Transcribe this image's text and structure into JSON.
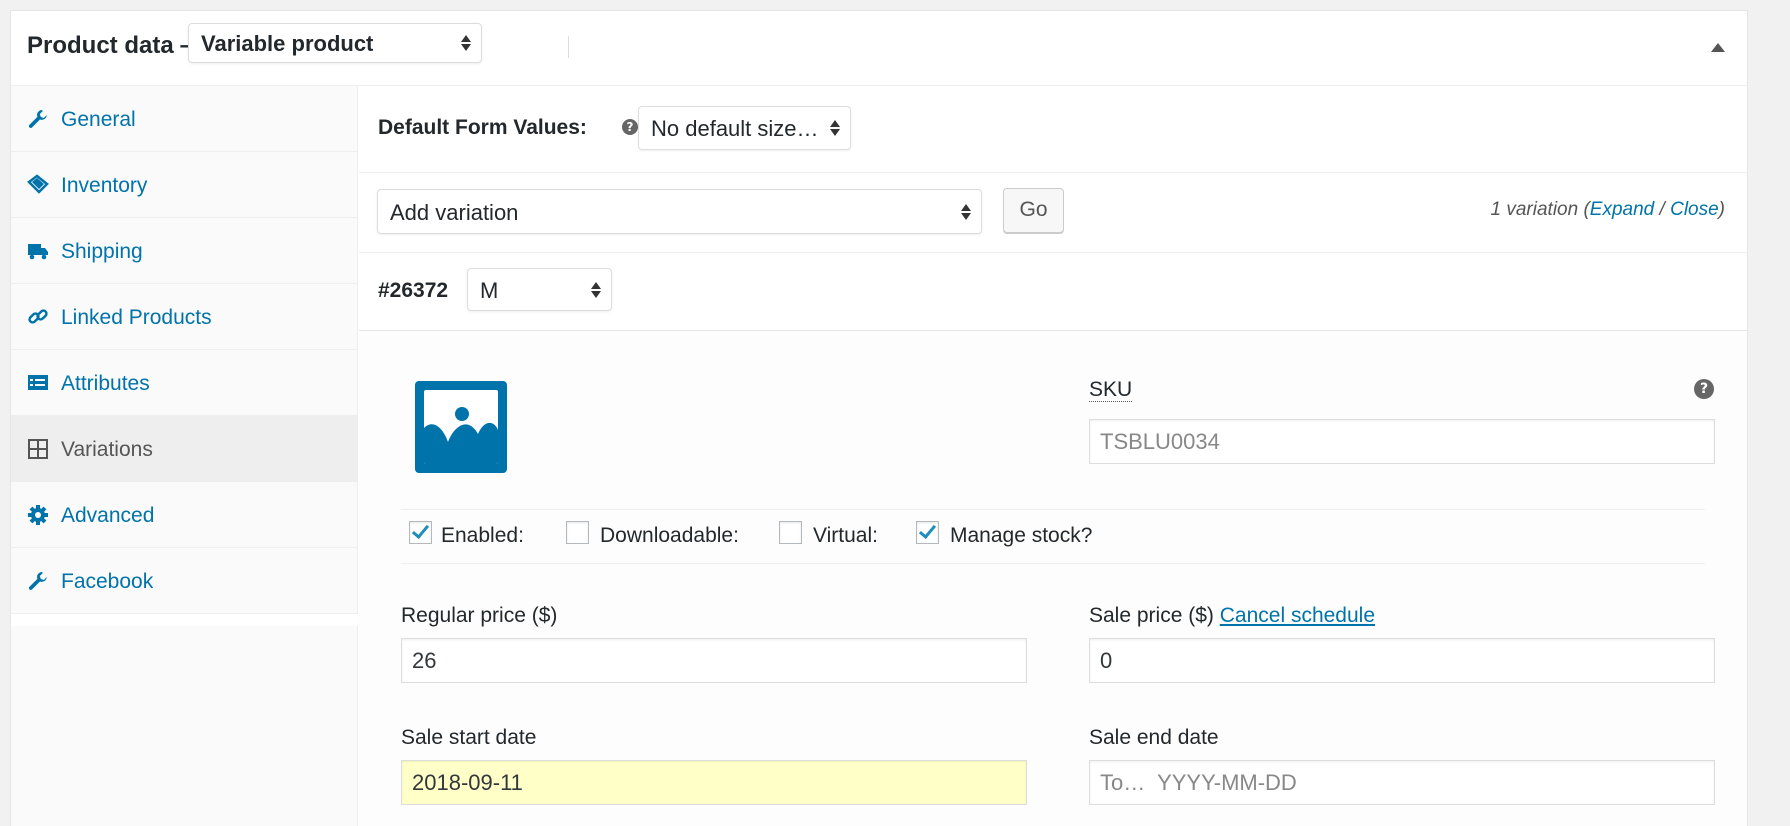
{
  "header": {
    "title": "Product data —",
    "product_type": "Variable product"
  },
  "sidebar": {
    "items": [
      {
        "label": "General",
        "icon": "wrench-icon"
      },
      {
        "label": "Inventory",
        "icon": "tag-icon"
      },
      {
        "label": "Shipping",
        "icon": "truck-icon"
      },
      {
        "label": "Linked Products",
        "icon": "link-icon"
      },
      {
        "label": "Attributes",
        "icon": "list-icon"
      },
      {
        "label": "Variations",
        "icon": "grid-icon"
      },
      {
        "label": "Advanced",
        "icon": "gear-icon"
      },
      {
        "label": "Facebook",
        "icon": "wrench-icon"
      }
    ],
    "active": "Variations"
  },
  "defaults": {
    "label": "Default Form Values:",
    "help": "?",
    "size_value": "No default size…"
  },
  "actions": {
    "add_select": "Add variation",
    "go_label": "Go",
    "count_text": "1 variation (",
    "expand": "Expand",
    "sep": " / ",
    "close": "Close",
    "count_end": ")"
  },
  "variation": {
    "id": "#26372",
    "size": "M",
    "sku_label": "SKU",
    "sku_help": "?",
    "sku_placeholder": "TSBLU0034",
    "checks": {
      "enabled": {
        "label": "Enabled:",
        "checked": true
      },
      "downloadable": {
        "label": "Downloadable:",
        "checked": false
      },
      "virtual": {
        "label": "Virtual:",
        "checked": false
      },
      "manage_stock": {
        "label": "Manage stock?",
        "checked": true
      }
    },
    "regular_price_label": "Regular price ($)",
    "regular_price": "26",
    "sale_price_label": "Sale price ($)",
    "cancel_schedule": "Cancel schedule",
    "sale_price": "0",
    "sale_start_label": "Sale start date",
    "sale_start": "2018-09-11",
    "sale_end_label": "Sale end date",
    "sale_end_placeholder": "To…  YYYY-MM-DD"
  },
  "colors": {
    "link": "#0073aa",
    "highlight_input": "#ffffc8"
  }
}
